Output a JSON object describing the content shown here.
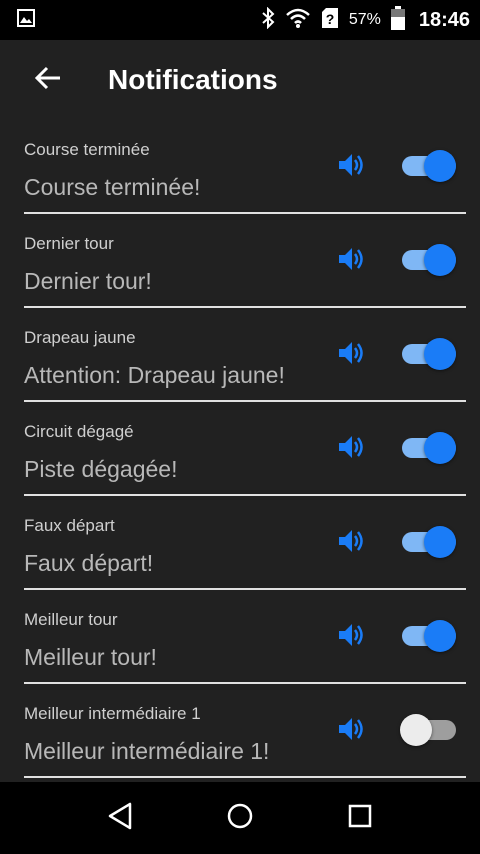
{
  "status_bar": {
    "battery": "57%",
    "time": "18:46",
    "icons": [
      "image-icon",
      "bluetooth-icon",
      "wifi-icon",
      "sim-unknown-icon",
      "battery-icon"
    ]
  },
  "app_bar": {
    "title": "Notifications",
    "back_icon": "arrow-back-icon"
  },
  "colors": {
    "accent": "#1a7cf7",
    "background": "#212121"
  },
  "notifications": [
    {
      "label": "Course terminée",
      "value": "Course terminée!",
      "enabled": true
    },
    {
      "label": "Dernier tour",
      "value": "Dernier tour!",
      "enabled": true
    },
    {
      "label": "Drapeau jaune",
      "value": "Attention: Drapeau jaune!",
      "enabled": true
    },
    {
      "label": "Circuit dégagé",
      "value": "Piste dégagée!",
      "enabled": true
    },
    {
      "label": "Faux départ",
      "value": "Faux départ!",
      "enabled": true
    },
    {
      "label": "Meilleur tour",
      "value": "Meilleur tour!",
      "enabled": true
    },
    {
      "label": "Meilleur intermédiaire 1",
      "value": "Meilleur intermédiaire 1!",
      "enabled": false
    }
  ],
  "nav_bar": {
    "icons": [
      "back-triangle-icon",
      "home-circle-icon",
      "recents-square-icon"
    ]
  }
}
